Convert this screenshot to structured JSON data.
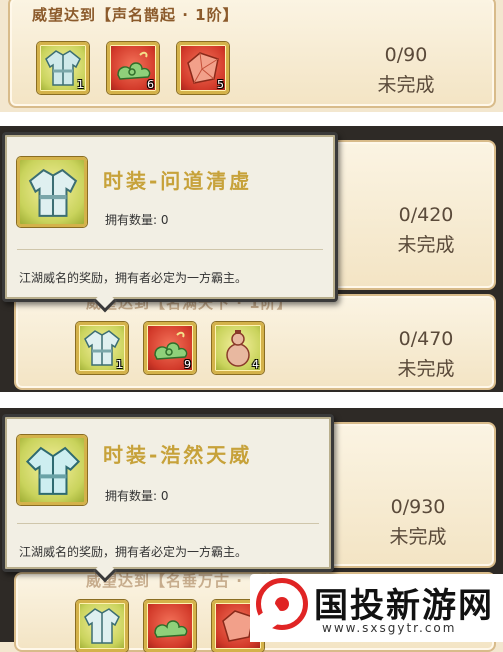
{
  "panels": [
    {
      "card_title": "威望达到【声名鹊起 · 1阶】",
      "progress": "0/90",
      "status": "未完成",
      "items": [
        {
          "icon": "robe-icon",
          "qty": "1"
        },
        {
          "icon": "cloud-icon",
          "qty": "6"
        },
        {
          "icon": "gem-icon",
          "qty": "5"
        }
      ]
    },
    {
      "card_title": "威望达到【名满天下 · 1阶】",
      "progress_top": "0/420",
      "status_top": "未完成",
      "progress": "0/470",
      "status": "未完成",
      "items": [
        {
          "icon": "robe-icon",
          "qty": "1"
        },
        {
          "icon": "cloud-icon",
          "qty": "9"
        },
        {
          "icon": "gourd-icon",
          "qty": "4"
        }
      ],
      "tooltip": {
        "name": "时装-问道清虚",
        "own_label": "拥有数量: 0",
        "desc": "江湖威名的奖励，拥有者必定为一方霸主。"
      }
    },
    {
      "card_title": "威望达到【名垂万古 · 1阶】",
      "progress": "0/930",
      "status": "未完成",
      "items": [
        {
          "icon": "robe-icon",
          "qty": ""
        },
        {
          "icon": "cloud-icon",
          "qty": ""
        },
        {
          "icon": "gem-icon",
          "qty": ""
        }
      ],
      "tooltip": {
        "name": "时装-浩然天威",
        "own_label": "拥有数量: 0",
        "desc": "江湖威名的奖励，拥有者必定为一方霸主。"
      }
    }
  ],
  "watermark": {
    "title": "国投新游网",
    "url": "www.sxsgytr.com"
  },
  "colors": {
    "card_bg": "#f8eed8",
    "card_border": "#d8bb8a",
    "title_text": "#8b5a2b",
    "tooltip_name": "#c7a23a",
    "watermark_red": "#e02424"
  }
}
